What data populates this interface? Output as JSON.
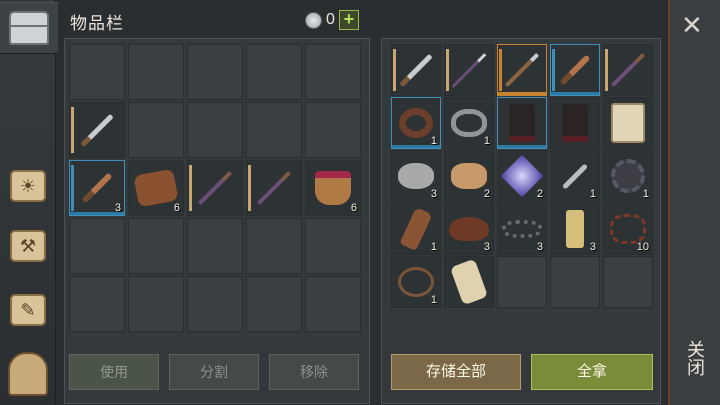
{
  "header": {
    "title": "物品栏",
    "currency_value": "0",
    "currency_icon": "silver-coin-icon",
    "add_label": "+"
  },
  "rail": [
    {
      "name": "chest-icon"
    },
    {
      "name": "sun-map-icon"
    },
    {
      "name": "hammer-icon"
    },
    {
      "name": "quest-scroll-icon"
    },
    {
      "name": "character-icon"
    }
  ],
  "inventory": {
    "slots": [
      {
        "icon": "",
        "count": ""
      },
      {
        "icon": "",
        "count": ""
      },
      {
        "icon": "",
        "count": ""
      },
      {
        "icon": "",
        "count": ""
      },
      {
        "icon": "",
        "count": ""
      },
      {
        "icon": "sword",
        "count": "",
        "dur": "#c9a870"
      },
      {
        "icon": "",
        "count": ""
      },
      {
        "icon": "",
        "count": ""
      },
      {
        "icon": "",
        "count": ""
      },
      {
        "icon": "",
        "count": ""
      },
      {
        "icon": "knife",
        "count": "3",
        "dur": "#3f8fb8",
        "hl": "blue"
      },
      {
        "icon": "hide",
        "count": "6"
      },
      {
        "icon": "mace",
        "count": "",
        "dur": "#c9a870"
      },
      {
        "icon": "mace",
        "count": "",
        "dur": "#c9a870"
      },
      {
        "icon": "pot",
        "count": "6"
      },
      {
        "icon": "",
        "count": ""
      },
      {
        "icon": "",
        "count": ""
      },
      {
        "icon": "",
        "count": ""
      },
      {
        "icon": "",
        "count": ""
      },
      {
        "icon": "",
        "count": ""
      },
      {
        "icon": "",
        "count": ""
      },
      {
        "icon": "",
        "count": ""
      },
      {
        "icon": "",
        "count": ""
      },
      {
        "icon": "",
        "count": ""
      },
      {
        "icon": "",
        "count": ""
      }
    ],
    "buttons": {
      "use": "使用",
      "split": "分割",
      "remove": "移除"
    }
  },
  "storage": {
    "slots": [
      {
        "icon": "sword",
        "count": "",
        "dur": "#c9a870"
      },
      {
        "icon": "spear",
        "count": "",
        "dur": "#c9a870"
      },
      {
        "icon": "axe",
        "count": "",
        "dur": "#c9822e",
        "hl": "orange"
      },
      {
        "icon": "knife",
        "count": "",
        "dur": "#3f8fb8",
        "hl": "blue"
      },
      {
        "icon": "mace",
        "count": "",
        "dur": "#c9a870"
      },
      {
        "icon": "collar",
        "count": "1",
        "hl": "blue"
      },
      {
        "icon": "cuff",
        "count": "1"
      },
      {
        "icon": "pants",
        "count": "",
        "hl": "blue"
      },
      {
        "icon": "pants",
        "count": ""
      },
      {
        "icon": "scroll",
        "count": ""
      },
      {
        "icon": "rock",
        "count": "3"
      },
      {
        "icon": "chips",
        "count": "2"
      },
      {
        "icon": "crystal",
        "count": "2"
      },
      {
        "icon": "spoon",
        "count": "1"
      },
      {
        "icon": "gear",
        "count": "1"
      },
      {
        "icon": "bottle",
        "count": "1"
      },
      {
        "icon": "leather",
        "count": "3"
      },
      {
        "icon": "chain",
        "count": "3"
      },
      {
        "icon": "candle",
        "count": "3"
      },
      {
        "icon": "net",
        "count": "10"
      },
      {
        "icon": "rope",
        "count": "1"
      },
      {
        "icon": "bundle",
        "count": ""
      },
      {
        "icon": "",
        "count": ""
      },
      {
        "icon": "",
        "count": ""
      },
      {
        "icon": "",
        "count": ""
      }
    ],
    "buttons": {
      "store_all": "存储全部",
      "take_all": "全拿"
    }
  },
  "close": {
    "icon": "close-icon",
    "label": "关闭"
  }
}
